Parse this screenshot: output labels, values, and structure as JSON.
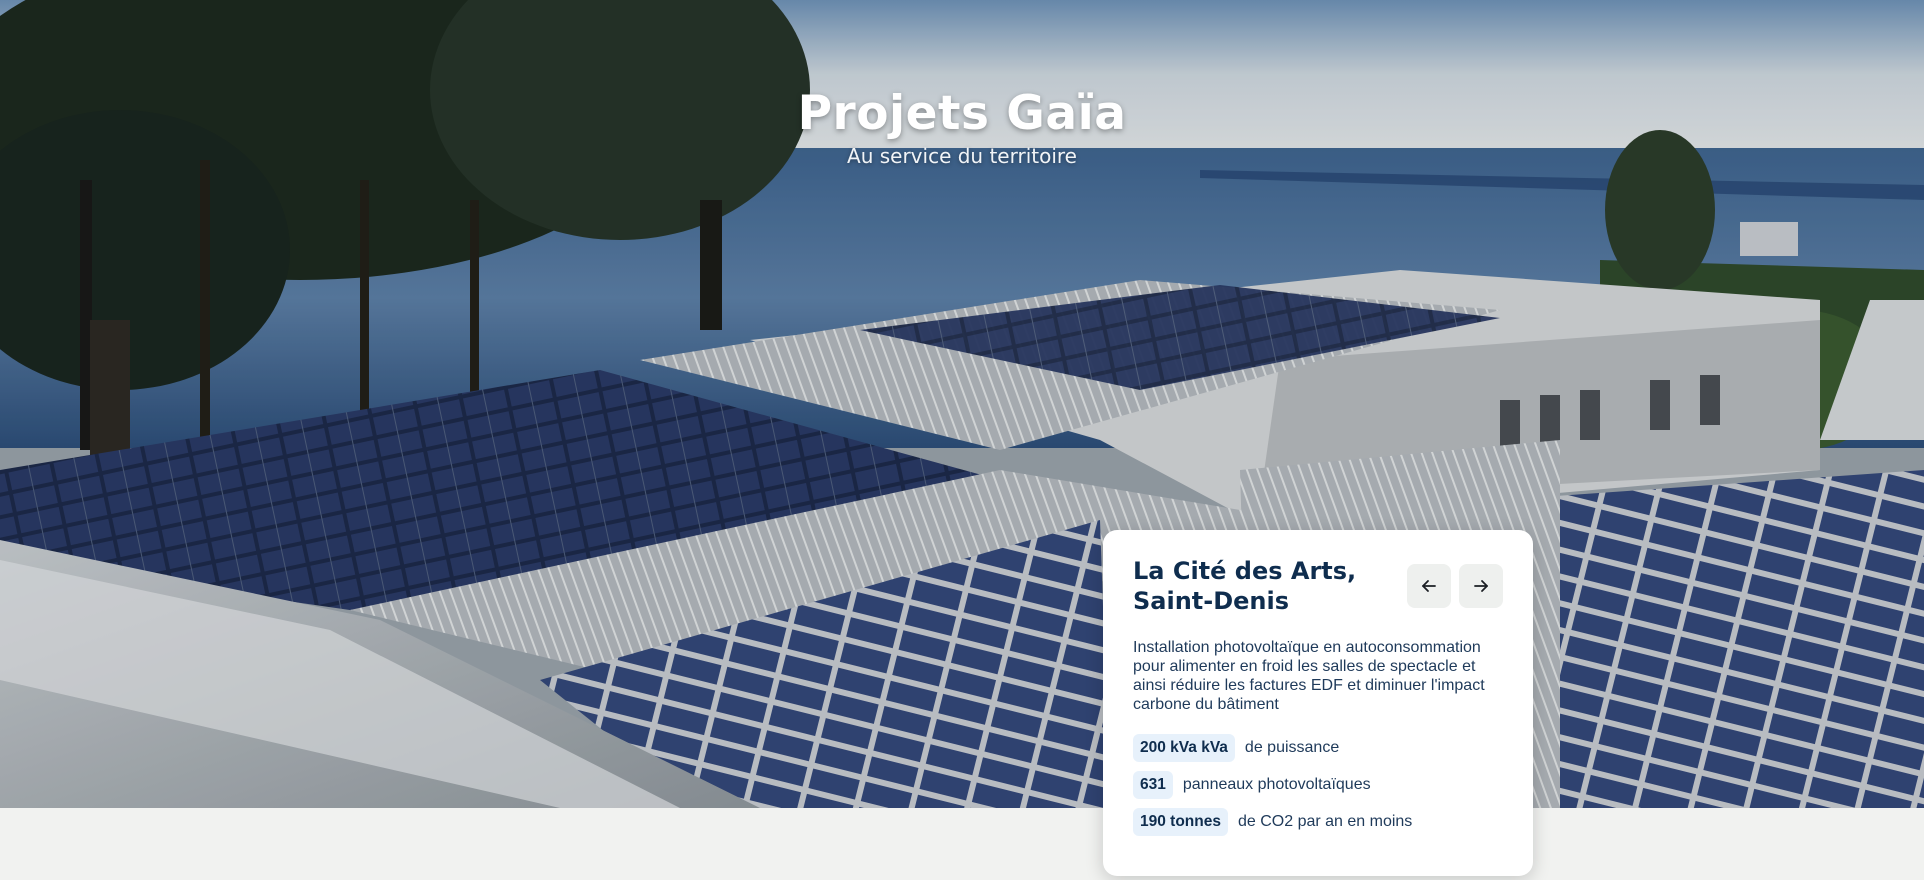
{
  "hero": {
    "title": "Projets Gaïa",
    "subtitle": "Au service du territoire"
  },
  "project": {
    "title": "La Cité des Arts, Saint-Denis",
    "description": "Installation photovoltaïque en autoconsommation pour alimenter en froid les salles de spectacle et ainsi réduire les factures EDF et diminuer l'impact carbone du bâtiment",
    "stats": [
      {
        "value": "200 kVa kVa",
        "label": "de puissance"
      },
      {
        "value": "631",
        "label": "panneaux photovoltaïques"
      },
      {
        "value": "190 tonnes",
        "label": "de CO2 par an en moins"
      }
    ]
  },
  "navigation": {
    "prev_icon": "arrow-left-icon",
    "next_icon": "arrow-right-icon"
  },
  "colors": {
    "title": "#0f2d4e",
    "badge_bg": "#e7f1fb",
    "page_bg": "#f1f2f0"
  }
}
